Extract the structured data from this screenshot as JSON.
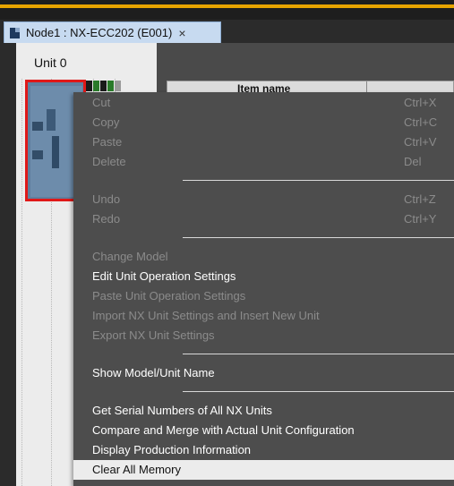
{
  "tab": {
    "title": "Node1 : NX-ECC202 (E001)",
    "close": "×"
  },
  "left_panel": {
    "unit_label": "Unit 0"
  },
  "table": {
    "header": "Item name"
  },
  "menu": {
    "groups": [
      [
        {
          "label": "Cut",
          "shortcut": "Ctrl+X",
          "enabled": false
        },
        {
          "label": "Copy",
          "shortcut": "Ctrl+C",
          "enabled": false
        },
        {
          "label": "Paste",
          "shortcut": "Ctrl+V",
          "enabled": false
        },
        {
          "label": "Delete",
          "shortcut": "Del",
          "enabled": false
        }
      ],
      [
        {
          "label": "Undo",
          "shortcut": "Ctrl+Z",
          "enabled": false
        },
        {
          "label": "Redo",
          "shortcut": "Ctrl+Y",
          "enabled": false
        }
      ],
      [
        {
          "label": "Change Model",
          "shortcut": "",
          "enabled": false
        },
        {
          "label": "Edit Unit Operation Settings",
          "shortcut": "",
          "enabled": true
        },
        {
          "label": "Paste Unit Operation Settings",
          "shortcut": "",
          "enabled": false
        },
        {
          "label": "Import NX Unit Settings and Insert New Unit",
          "shortcut": "",
          "enabled": false
        },
        {
          "label": "Export NX Unit Settings",
          "shortcut": "",
          "enabled": false
        }
      ],
      [
        {
          "label": "Show Model/Unit Name",
          "shortcut": "",
          "enabled": true
        }
      ],
      [
        {
          "label": "Get Serial Numbers of All NX Units",
          "shortcut": "",
          "enabled": true
        },
        {
          "label": "Compare and Merge with Actual Unit Configuration",
          "shortcut": "",
          "enabled": true
        },
        {
          "label": "Display Production Information",
          "shortcut": "",
          "enabled": true
        },
        {
          "label": "Clear All Memory",
          "shortcut": "",
          "enabled": true,
          "highlighted": true
        }
      ]
    ]
  },
  "colors": {
    "menu_bg": "#4d4d4d",
    "selection_border": "#e01818",
    "tab_bg": "#c7daf0",
    "toolbar_accent": "#e8a400"
  }
}
